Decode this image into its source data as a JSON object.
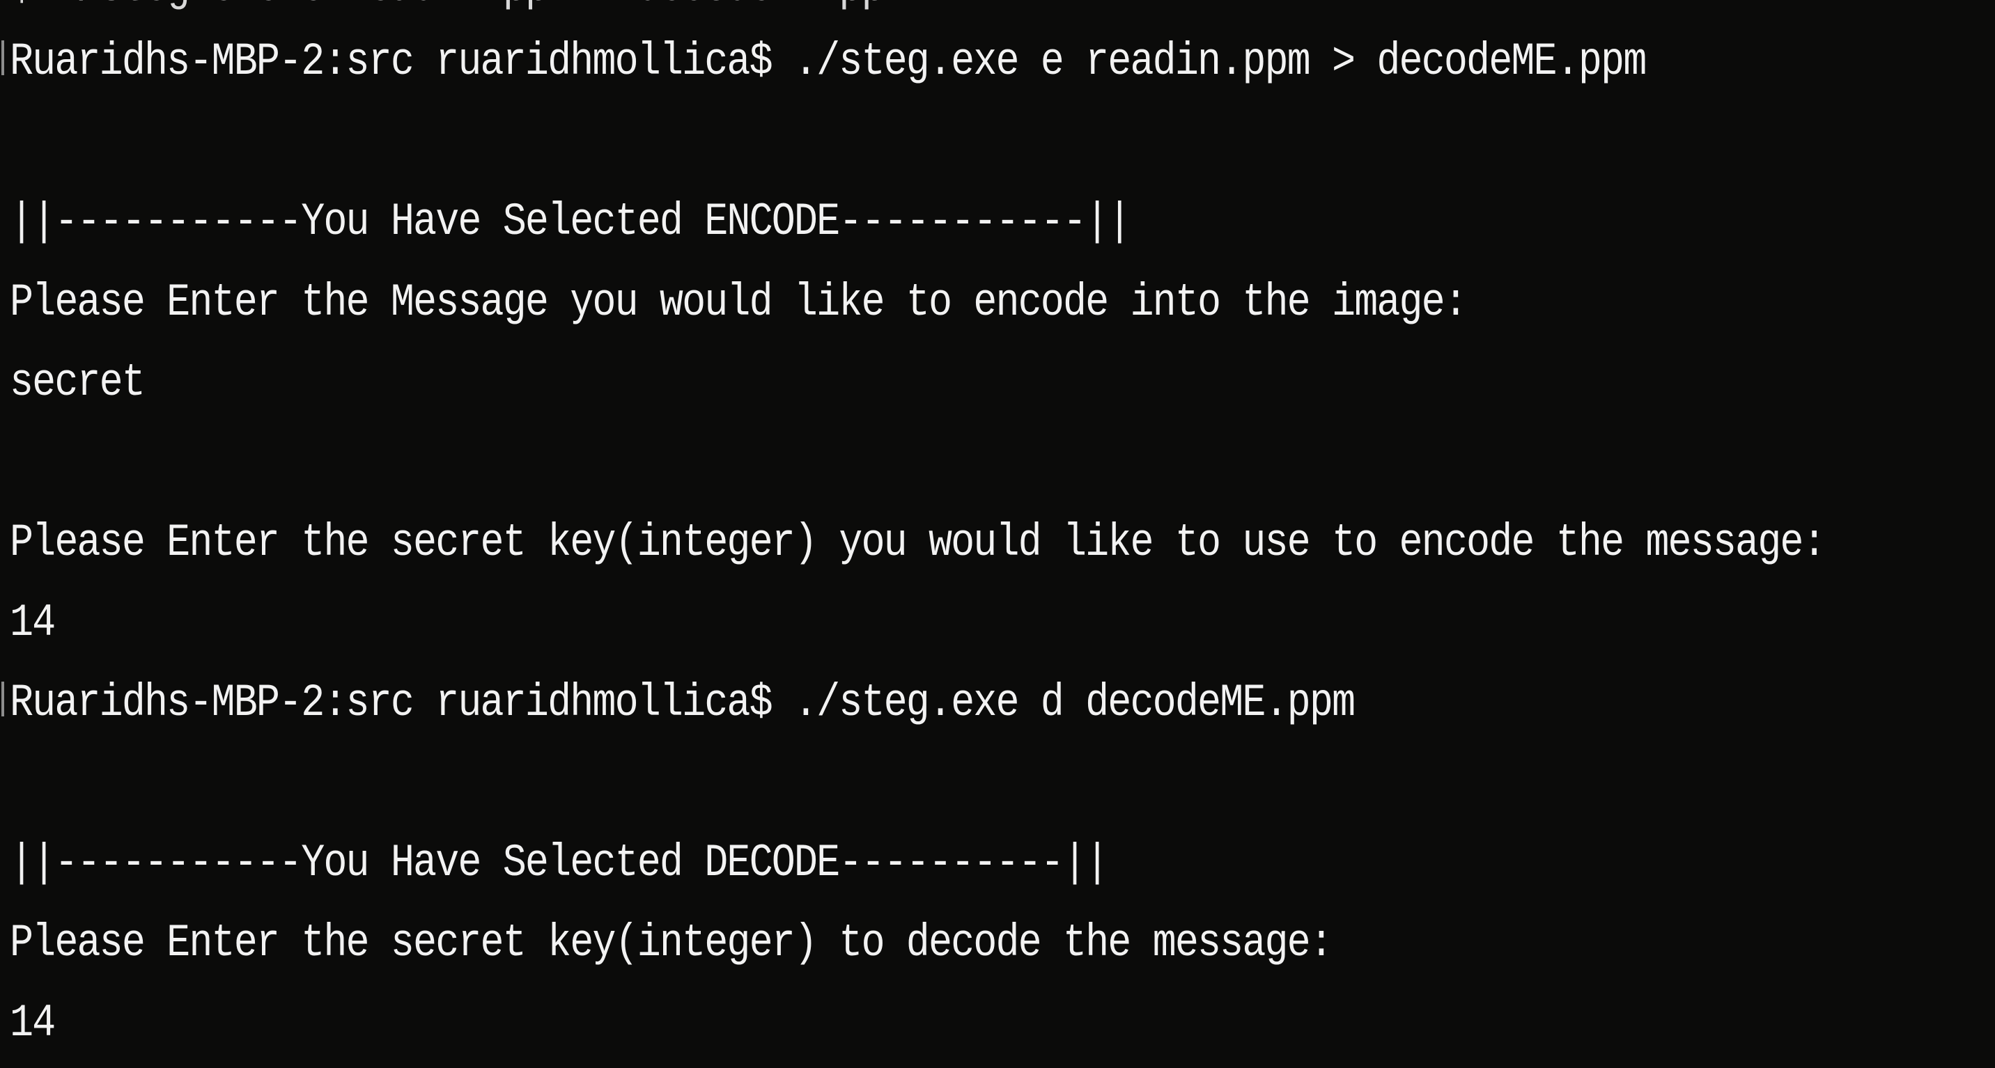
{
  "terminal": {
    "lines": [
      "$ ./steg.exe e readin.ppm > decodeME.ppm",
      "Ruaridhs-MBP-2:src ruaridhmollica$ ./steg.exe e readin.ppm > decodeME.ppm",
      "||-----------You Have Selected ENCODE-----------||",
      "Please Enter the Message you would like to encode into the image:",
      "secret",
      "Please Enter the secret key(integer) you would like to use to encode the message:",
      "14",
      "Ruaridhs-MBP-2:src ruaridhmollica$ ./steg.exe d decodeME.ppm",
      "||-----------You Have Selected DECODE----------||",
      "Please Enter the secret key(integer) to decode the message:",
      "14"
    ]
  }
}
